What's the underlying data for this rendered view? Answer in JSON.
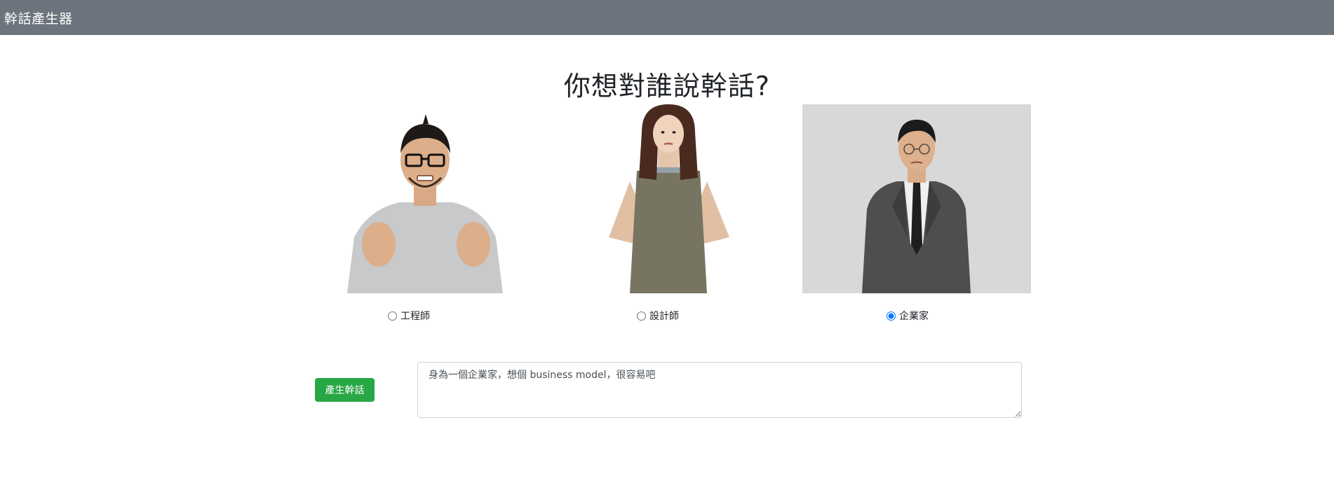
{
  "navbar": {
    "brand": "幹話產生器"
  },
  "main": {
    "title": "你想對誰說幹話?",
    "options": [
      {
        "label": "工程師",
        "selected": false
      },
      {
        "label": "設計師",
        "selected": false
      },
      {
        "label": "企業家",
        "selected": true
      }
    ],
    "generate_label": "產生幹話",
    "output_text": "身為一個企業家，想個 business model，很容易吧"
  }
}
